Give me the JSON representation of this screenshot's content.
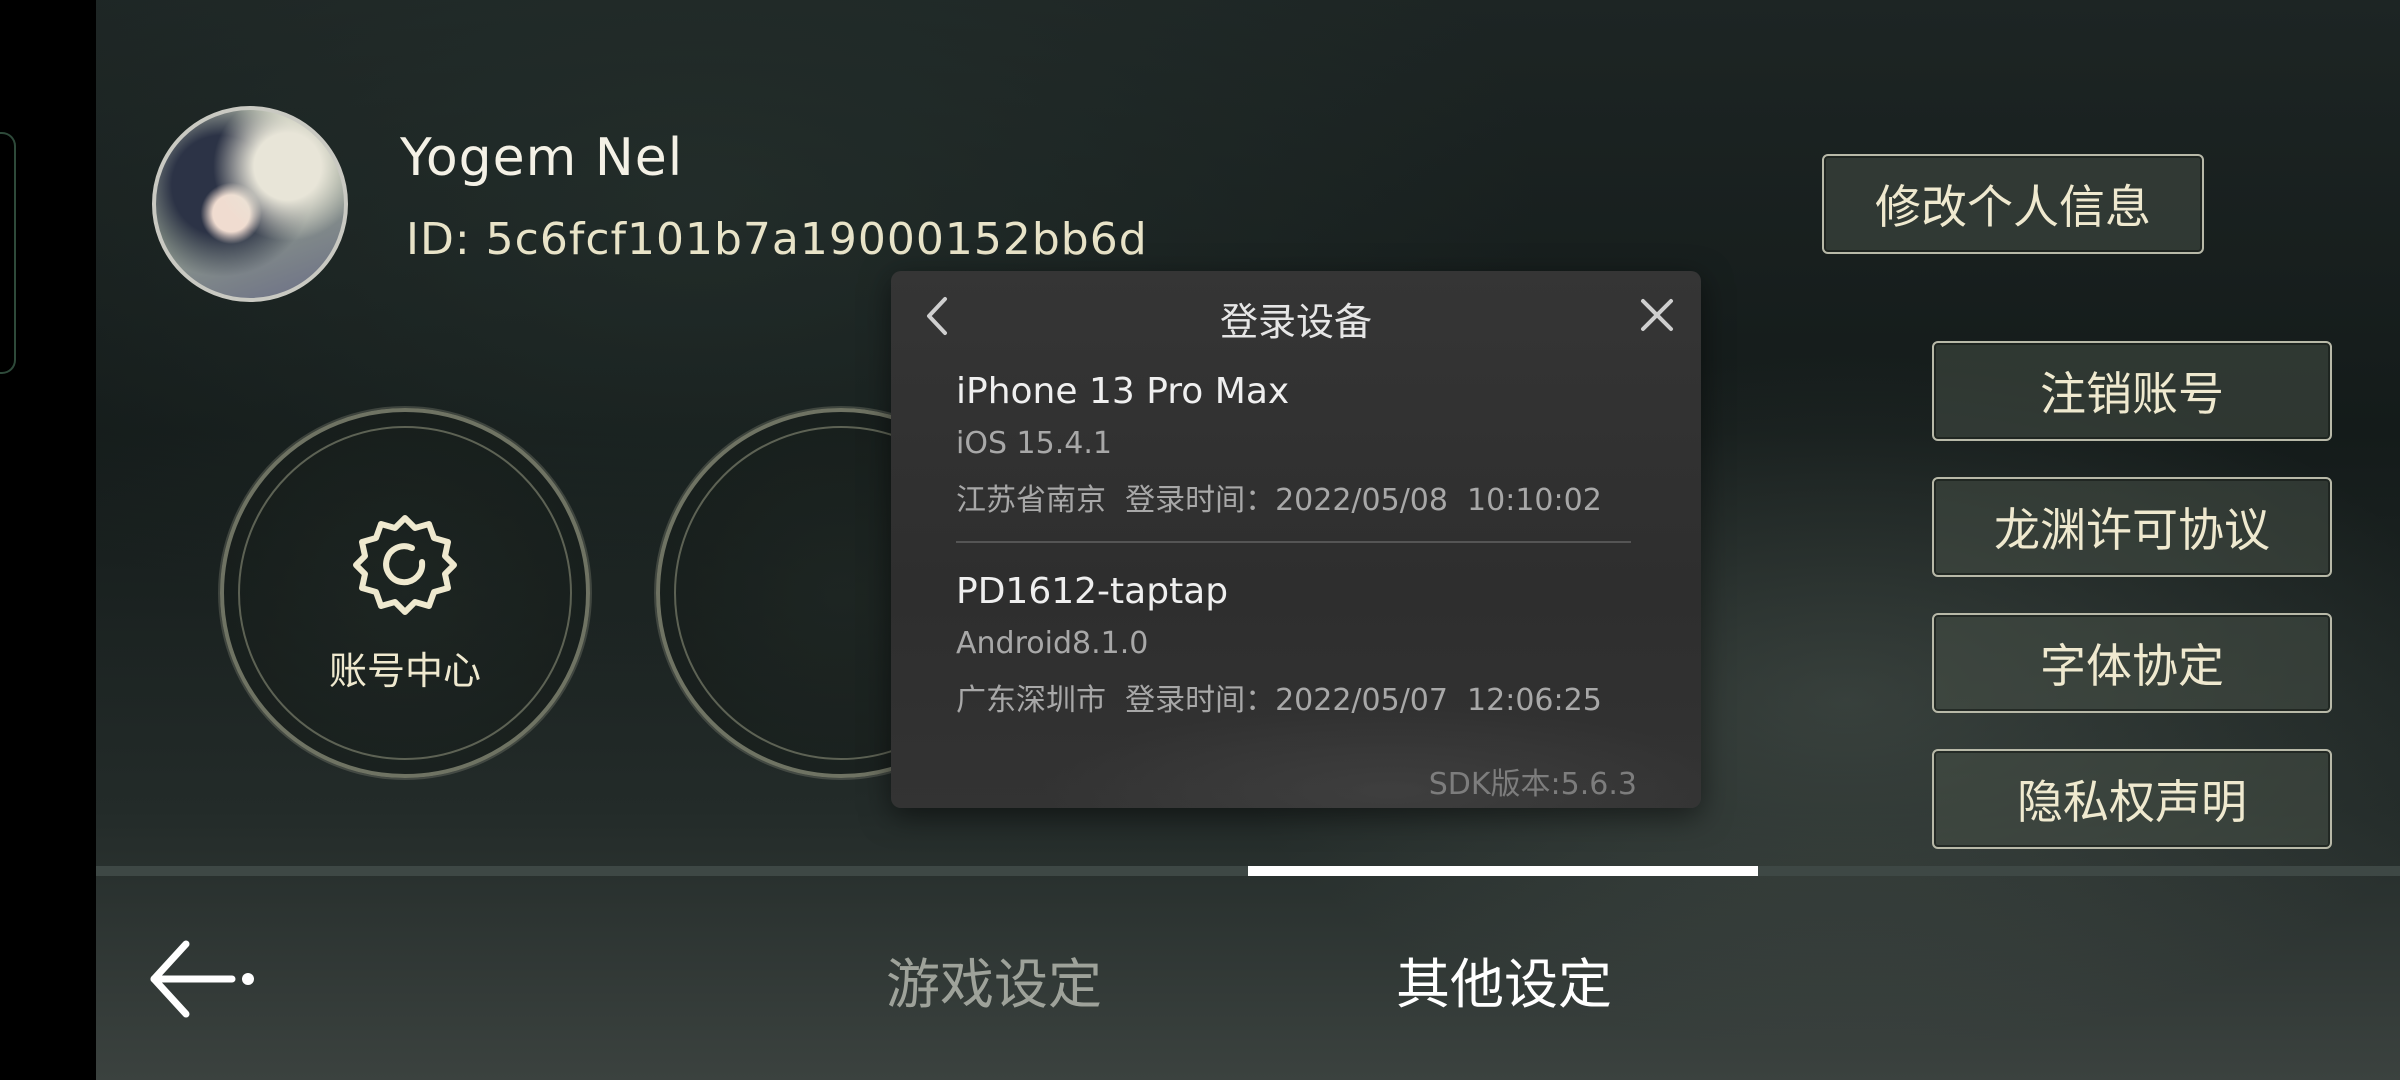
{
  "profile": {
    "name": "Yogem Nel",
    "id": "ID: 5c6fcf101b7a19000152bb6d"
  },
  "buttons": {
    "edit_profile": "修改个人信息",
    "delete_account": "注销账号",
    "license": "龙渊许可协议",
    "font_agreement": "字体协定",
    "privacy": "隐私权声明"
  },
  "circle_buttons": {
    "account_center": "账号中心"
  },
  "tabs": {
    "game_settings": "游戏设定",
    "other_settings": "其他设定",
    "active": "其他设定"
  },
  "modal": {
    "title": "登录设备",
    "devices": [
      {
        "name": "iPhone 13 Pro Max",
        "os": "iOS 15.4.1",
        "location_time": "江苏省南京  登录时间：2022/05/08  10:10:02"
      },
      {
        "name": "PD1612-taptap",
        "os": "Android8.1.0",
        "location_time": "广东深圳市  登录时间：2022/05/07  12:06:25"
      }
    ],
    "sdk_version": "SDK版本:5.6.3"
  },
  "icons": {
    "settings": "gear-icon",
    "back": "arrow-left-icon",
    "modal_back": "chevron-left-icon",
    "modal_close": "close-icon"
  },
  "colors": {
    "accent_text": "#efe9cf",
    "active_tab": "#ffffff",
    "inactive_tab": "#9ea29a"
  }
}
